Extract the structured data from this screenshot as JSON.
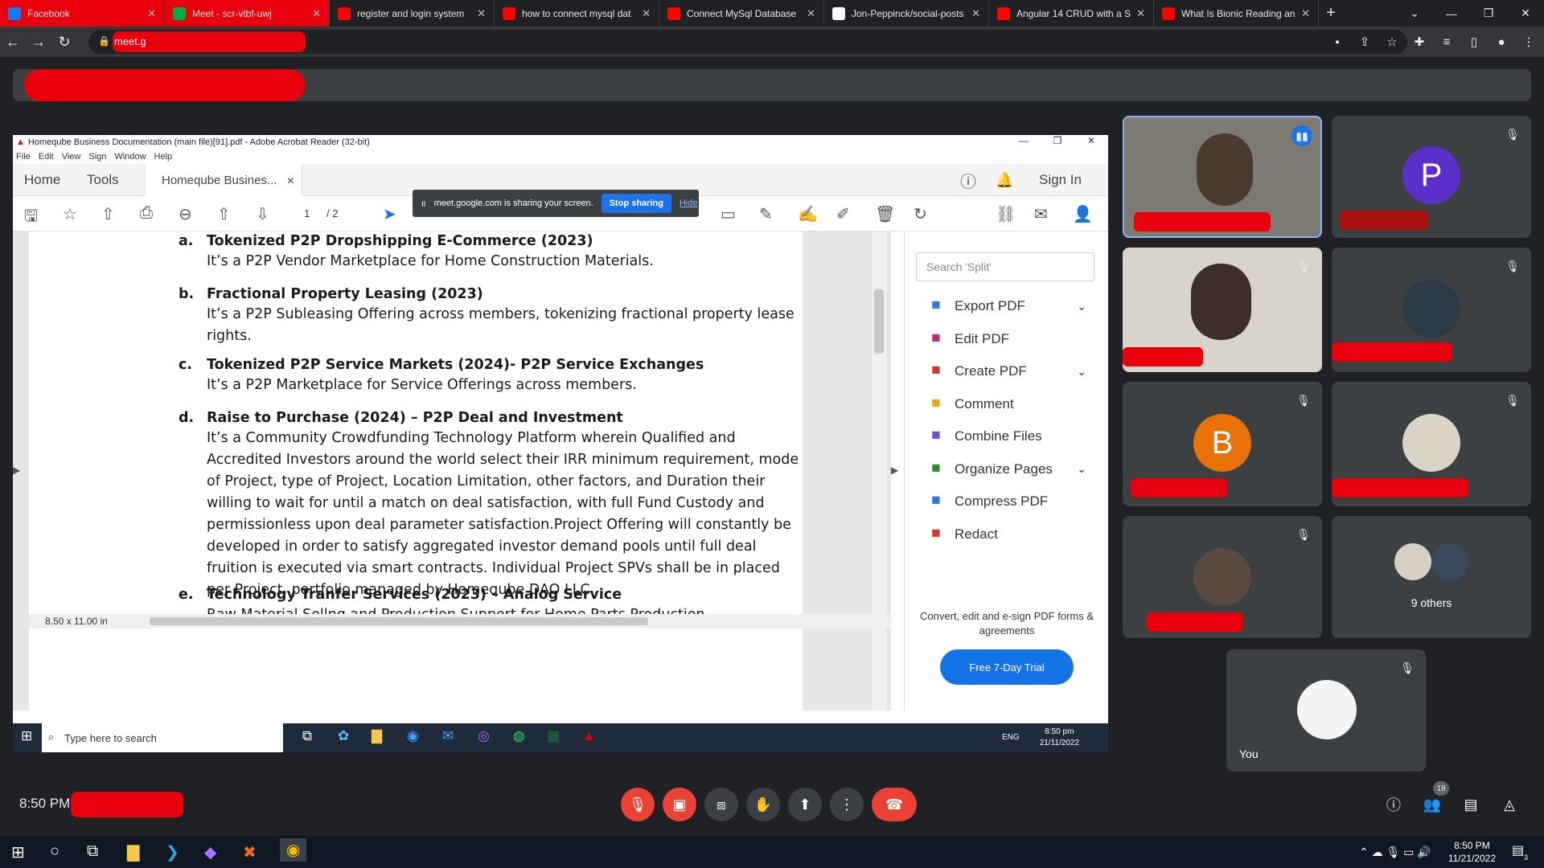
{
  "browser": {
    "tabs": [
      {
        "title": "Facebook",
        "redacted": true,
        "icon": "facebook-icon",
        "color": "#1877f2"
      },
      {
        "title": "Meet - scr-vtbf-uwj",
        "redacted": true,
        "icon": "meet-icon",
        "color": "#00ac47"
      },
      {
        "title": "register and login system",
        "icon": "youtube-icon",
        "color": "#ff0000"
      },
      {
        "title": "how to connect mysql dat",
        "icon": "youtube-icon",
        "color": "#ff0000"
      },
      {
        "title": "Connect MySql Database",
        "icon": "youtube-icon",
        "color": "#ff0000"
      },
      {
        "title": "Jon-Peppinck/social-posts",
        "icon": "github-icon",
        "color": "#ffffff"
      },
      {
        "title": "Angular 14 CRUD with a S",
        "icon": "youtube-icon",
        "color": "#ff0000"
      },
      {
        "title": "What Is Bionic Reading an",
        "icon": "youtube-icon",
        "color": "#ff0000"
      }
    ],
    "url": "meet.g"
  },
  "acrobat": {
    "window_title": "Homeqube Business Documentation (main file)[91].pdf - Adobe Acrobat Reader (32-bit)",
    "menu": [
      "File",
      "Edit",
      "View",
      "Sign",
      "Window",
      "Help"
    ],
    "tab_home": "Home",
    "tab_tools": "Tools",
    "doc_tab": "Homeqube Busines...",
    "sign_in": "Sign In",
    "page_current": "1",
    "page_total": "/ 2",
    "share_notice": "meet.google.com is sharing your screen.",
    "stop_sharing": "Stop sharing",
    "hide": "Hide",
    "page_size": "8.50 x 11.00 in",
    "search_placeholder": "Search 'Split'",
    "tools_panel": [
      {
        "label": "Export PDF",
        "icon": "export-pdf-icon",
        "chevron": true
      },
      {
        "label": "Edit PDF",
        "icon": "edit-pdf-icon",
        "chevron": false
      },
      {
        "label": "Create PDF",
        "icon": "create-pdf-icon",
        "chevron": true
      },
      {
        "label": "Comment",
        "icon": "comment-icon",
        "chevron": false
      },
      {
        "label": "Combine Files",
        "icon": "combine-files-icon",
        "chevron": false
      },
      {
        "label": "Organize Pages",
        "icon": "organize-pages-icon",
        "chevron": true
      },
      {
        "label": "Compress PDF",
        "icon": "compress-pdf-icon",
        "chevron": false
      },
      {
        "label": "Redact",
        "icon": "redact-icon",
        "chevron": false
      }
    ],
    "panel_footer": "Convert, edit and e-sign PDF forms & agreements",
    "trial_button": "Free 7-Day Trial"
  },
  "document": {
    "items": [
      {
        "letter": "a.",
        "title": "Tokenized P2P Dropshipping E-Commerce (2023)",
        "body": "It’s a P2P Vendor Marketplace for Home Construction Materials."
      },
      {
        "letter": "b.",
        "title": "Fractional Property Leasing (2023)",
        "body": "It’s a P2P Subleasing Offering across members, tokenizing fractional property lease rights."
      },
      {
        "letter": "c.",
        "title": "Tokenized P2P Service Markets (2024)- P2P Service Exchanges",
        "body": "It’s a P2P Marketplace for Service Offerings across members."
      },
      {
        "letter": "d.",
        "title": "Raise to Purchase (2024) – P2P Deal and Investment",
        "body": "It’s a Community Crowdfunding Technology Platform wherein Qualified and Accredited Investors around the world select their IRR minimum requirement, mode of Project, type of Project, Location Limitation, other factors, and Duration their willing to wait for until a match on deal satisfaction, with full Fund Custody and permissionless upon deal parameter satisfaction.Project Offering will constantly be developed in order to satisfy aggregated investor demand pools until full deal fruition is executed via smart contracts. Individual Project SPVs shall be in placed per Project, portfolio managed by Homeqube DAO LLC."
      },
      {
        "letter": "e.",
        "title": "Technology Tranfer Services (2023) – Analog Service",
        "body": "Raw Material Sellng and Production Support for Home Parts Production"
      }
    ]
  },
  "inner_taskbar": {
    "search": "Type here to search",
    "time": "8:50 pm",
    "date": "21/11/2022",
    "lang": "ENG"
  },
  "meet": {
    "participants": [
      {
        "name": "P",
        "avatar_color": "#5b2fc9"
      },
      {
        "name": "B",
        "avatar_color": "#e8710a"
      },
      {
        "name": "9 others"
      },
      {
        "name": "You"
      }
    ],
    "time": "8:50 PM",
    "people_count": "18",
    "colors": {
      "end_call": "#ea4335",
      "muted": "#ea4335",
      "control": "#3c4043"
    }
  },
  "os_taskbar": {
    "time": "8:50 PM",
    "date": "11/21/2022",
    "notifications": "3"
  }
}
